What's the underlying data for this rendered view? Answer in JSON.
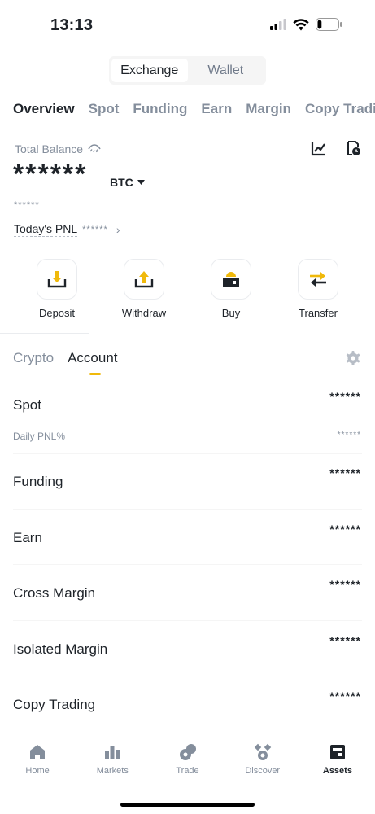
{
  "status": {
    "time": "13:13",
    "battery_level": 0.2
  },
  "segment": {
    "options": [
      "Exchange",
      "Wallet"
    ],
    "active": "Exchange"
  },
  "tabs": [
    "Overview",
    "Spot",
    "Funding",
    "Earn",
    "Margin",
    "Copy Trading"
  ],
  "balance": {
    "label": "Total Balance",
    "hidden_value": "******",
    "coin": "BTC",
    "fiat_value": "******",
    "pnl_label": "Today's PNL",
    "pnl_value": "******"
  },
  "actions": [
    {
      "label": "Deposit",
      "icon": "deposit-icon"
    },
    {
      "label": "Withdraw",
      "icon": "withdraw-icon"
    },
    {
      "label": "Buy",
      "icon": "buy-wallet-icon"
    },
    {
      "label": "Transfer",
      "icon": "transfer-icon"
    }
  ],
  "content_tabs": {
    "items": [
      "Crypto",
      "Account"
    ],
    "active": "Account"
  },
  "accounts": [
    {
      "name": "Spot",
      "value": "******",
      "sub_label": "Daily PNL%",
      "sub_value": "******"
    },
    {
      "name": "Funding",
      "value": "******"
    },
    {
      "name": "Earn",
      "value": "******"
    },
    {
      "name": "Cross Margin",
      "value": "******"
    },
    {
      "name": "Isolated Margin",
      "value": "******"
    },
    {
      "name": "Copy Trading",
      "value": "******"
    }
  ],
  "nav": [
    {
      "label": "Home",
      "icon": "home-icon"
    },
    {
      "label": "Markets",
      "icon": "markets-icon"
    },
    {
      "label": "Trade",
      "icon": "trade-icon"
    },
    {
      "label": "Discover",
      "icon": "discover-icon"
    },
    {
      "label": "Assets",
      "icon": "assets-icon",
      "active": true
    }
  ],
  "colors": {
    "accent": "#f0b90b",
    "text": "#1e2329",
    "muted": "#848e9c"
  }
}
